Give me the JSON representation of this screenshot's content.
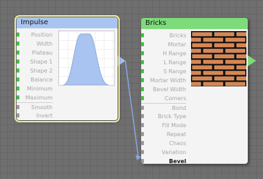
{
  "impulse": {
    "title": "Impulse",
    "inputs": [
      {
        "label": "Position",
        "kind": "green"
      },
      {
        "label": "Width",
        "kind": "green"
      },
      {
        "label": "Plateau",
        "kind": "green"
      },
      {
        "label": "Shape 1",
        "kind": "green"
      },
      {
        "label": "Shape 2",
        "kind": "green"
      },
      {
        "label": "Balance",
        "kind": "green"
      },
      {
        "label": "Minimum",
        "kind": "green"
      },
      {
        "label": "Maximum",
        "kind": "green"
      },
      {
        "label": "Smooth",
        "kind": "grey"
      },
      {
        "label": "Invert",
        "kind": "grey"
      }
    ]
  },
  "bricks": {
    "title": "Bricks",
    "inputs": [
      {
        "label": "Bricks",
        "kind": "green"
      },
      {
        "label": "Mortar",
        "kind": "green"
      },
      {
        "label": "H Range",
        "kind": "green"
      },
      {
        "label": "L Range",
        "kind": "green"
      },
      {
        "label": "S Range",
        "kind": "green"
      },
      {
        "label": "Mortar Width",
        "kind": "green"
      },
      {
        "label": "Bevel Width",
        "kind": "green"
      },
      {
        "label": "Corners",
        "kind": "green"
      },
      {
        "label": "Bond",
        "kind": "grey"
      },
      {
        "label": "Brick Type",
        "kind": "grey"
      },
      {
        "label": "Fill Mode",
        "kind": "grey"
      },
      {
        "label": "Repeat",
        "kind": "grey"
      },
      {
        "label": "Chaos",
        "kind": "grey"
      },
      {
        "label": "Variation",
        "kind": "grey"
      },
      {
        "label": "Bevel",
        "kind": "grey",
        "connected": true
      }
    ]
  },
  "colors": {
    "impulse_header": "#a9c4f0",
    "bricks_header": "#7ddb7a",
    "connection": "#8aa6e6",
    "curve_fill": "#a9c4f0",
    "brick": "#e0905a",
    "mortar": "#111111"
  }
}
